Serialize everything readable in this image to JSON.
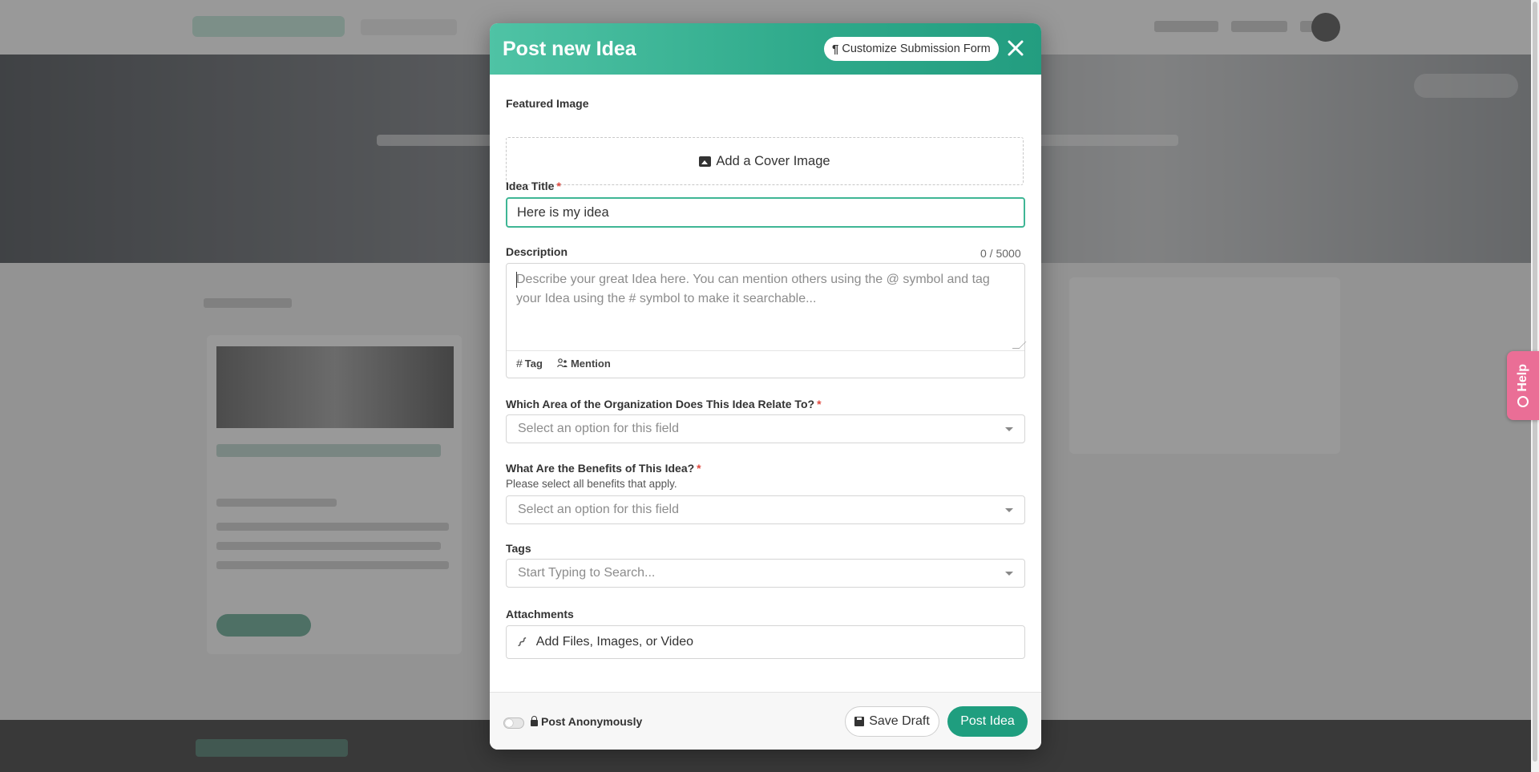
{
  "modal": {
    "title": "Post new Idea",
    "customize_label": "Customize Submission Form",
    "fields": {
      "featured_image_label": "Featured Image",
      "cover_image_label": "Add a Cover Image",
      "idea_title_label": "Idea Title",
      "required_mark": "*",
      "idea_title_value": "Here is my idea",
      "description_label": "Description",
      "description_count": "0 / 5000",
      "description_placeholder": "Describe your great Idea here. You can mention others using the @ symbol and tag your Idea using the # symbol to make it searchable...",
      "tag_label": "Tag",
      "tag_glyph": "#",
      "mention_label": "Mention",
      "area_label": "Which Area of the Organization Does This Idea Relate To?",
      "area_placeholder": "Select an option for this field",
      "benefits_label": "What Are the Benefits of This Idea?",
      "benefits_help": "Please select all benefits that apply.",
      "benefits_placeholder": "Select an option for this field",
      "tags_label": "Tags",
      "tags_placeholder": "Start Typing to Search...",
      "attachments_label": "Attachments",
      "attachments_placeholder": "Add Files, Images, or Video"
    },
    "footer": {
      "anonymous_label": "Post Anonymously",
      "anonymous_enabled": false,
      "save_draft_label": "Save Draft",
      "post_label": "Post Idea"
    }
  },
  "help_tab": {
    "label": "Help"
  },
  "colors": {
    "header_gradient_start": "#4fc3a5",
    "header_gradient_end": "#239d80",
    "primary_button": "#1f9e7f",
    "required": "#e0483e",
    "help_tab": "#ea6e96"
  }
}
